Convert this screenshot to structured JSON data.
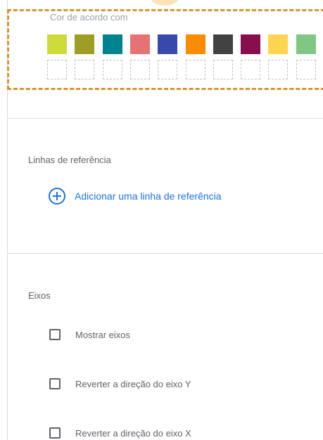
{
  "color_panel": {
    "title": "Cor de acordo com",
    "swatches": [
      "#cddc39",
      "#9e9d24",
      "#00838f",
      "#e57373",
      "#3949ab",
      "#fb8c00",
      "#424242",
      "#880e4f",
      "#ffd54f",
      "#81c784"
    ],
    "highlight_color": "#d8952f"
  },
  "reference_lines": {
    "title": "Linhas de referência",
    "add_label": "Adicionar uma linha de referência",
    "accent_color": "#1a73e8"
  },
  "axes": {
    "title": "Eixos",
    "options": [
      {
        "label": "Mostrar eixos",
        "checked": false
      },
      {
        "label": "Reverter a direção do eixo Y",
        "checked": false
      },
      {
        "label": "Reverter a direção do eixo X",
        "checked": false
      }
    ]
  }
}
